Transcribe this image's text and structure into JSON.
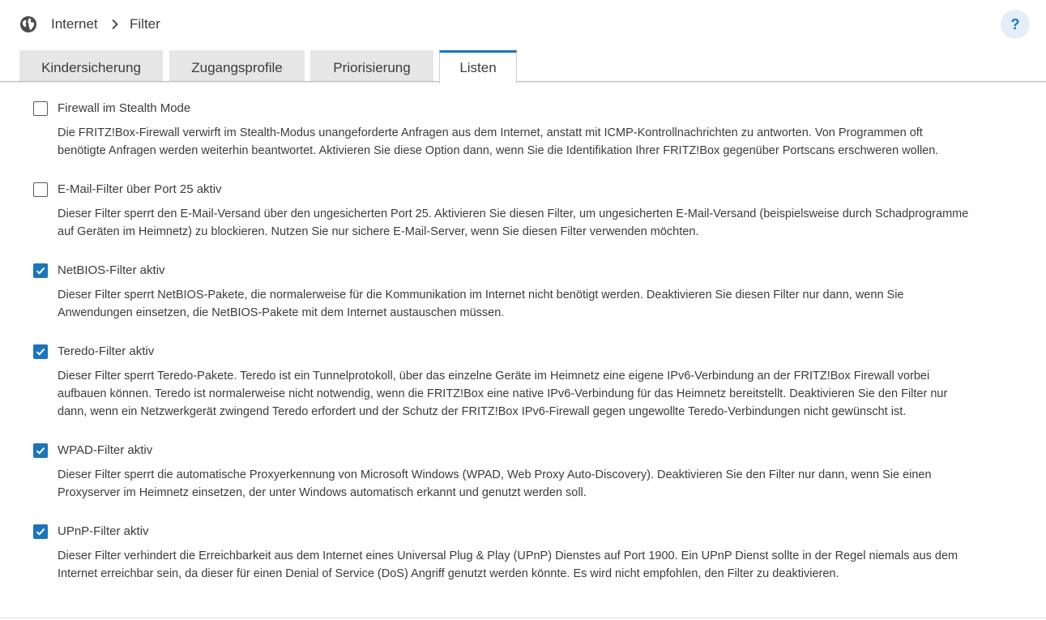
{
  "breadcrumb": {
    "icon": "globe-icon",
    "items": [
      "Internet",
      "Filter"
    ]
  },
  "help": {
    "label": "?"
  },
  "tabs": [
    {
      "label": "Kindersicherung",
      "active": false
    },
    {
      "label": "Zugangsprofile",
      "active": false
    },
    {
      "label": "Priorisierung",
      "active": false
    },
    {
      "label": "Listen",
      "active": true
    }
  ],
  "options": [
    {
      "label": "Firewall im Stealth Mode",
      "checked": false,
      "description_lines": [
        "Die FRITZ!Box-Firewall verwirft im Stealth-Modus unangeforderte Anfragen aus dem Internet, anstatt mit ICMP-Kontrollnachrichten zu antworten. Von Programmen oft",
        "benötigte Anfragen werden weiterhin beantwortet. Aktivieren Sie diese Option dann, wenn Sie die Identifikation Ihrer FRITZ!Box gegenüber Portscans erschweren wollen."
      ]
    },
    {
      "label": "E-Mail-Filter über Port 25 aktiv",
      "checked": false,
      "description_lines": [
        "Dieser Filter sperrt den E-Mail-Versand über den ungesicherten Port 25. Aktivieren Sie diesen Filter, um ungesicherten E-Mail-Versand (beispielsweise durch Schadprogramme",
        "auf Geräten im Heimnetz) zu blockieren. Nutzen Sie nur sichere E-Mail-Server, wenn Sie diesen Filter verwenden möchten."
      ]
    },
    {
      "label": "NetBIOS-Filter aktiv",
      "checked": true,
      "description_lines": [
        "Dieser Filter sperrt NetBIOS-Pakete, die normalerweise für die Kommunikation im Internet nicht benötigt werden. Deaktivieren Sie diesen Filter nur dann, wenn Sie",
        "Anwendungen einsetzen, die NetBIOS-Pakete mit dem Internet austauschen müssen."
      ]
    },
    {
      "label": "Teredo-Filter aktiv",
      "checked": true,
      "description_lines": [
        "Dieser Filter sperrt Teredo-Pakete. Teredo ist ein Tunnelprotokoll, über das einzelne Geräte im Heimnetz eine eigene IPv6-Verbindung an der FRITZ!Box Firewall vorbei",
        "aufbauen können. Teredo ist normalerweise nicht notwendig, wenn die FRITZ!Box eine native IPv6-Verbindung für das Heimnetz bereitstellt. Deaktivieren Sie den Filter nur",
        "dann, wenn ein Netzwerkgerät zwingend Teredo erfordert und der Schutz der FRITZ!Box IPv6-Firewall gegen ungewollte Teredo-Verbindungen nicht gewünscht ist."
      ]
    },
    {
      "label": "WPAD-Filter aktiv",
      "checked": true,
      "description_lines": [
        "Dieser Filter sperrt die automatische Proxyerkennung von Microsoft Windows (WPAD, Web Proxy Auto-Discovery). Deaktivieren Sie den Filter nur dann, wenn Sie einen",
        "Proxyserver im Heimnetz einsetzen, der unter Windows automatisch erkannt und genutzt werden soll."
      ]
    },
    {
      "label": "UPnP-Filter aktiv",
      "checked": true,
      "description_lines": [
        "Dieser Filter verhindert die Erreichbarkeit aus dem Internet eines Universal Plug & Play (UPnP) Dienstes auf Port 1900. Ein UPnP Dienst sollte in der Regel niemals aus dem",
        "Internet erreichbar sein, da dieser für einen Denial of Service (DoS) Angriff genutzt werden könnte. Es wird nicht empfohlen, den Filter zu deaktivieren."
      ]
    }
  ],
  "colors": {
    "accent": "#1b75bb",
    "tab_inactive": "#e6e6e6",
    "text": "#3c3c3c"
  }
}
